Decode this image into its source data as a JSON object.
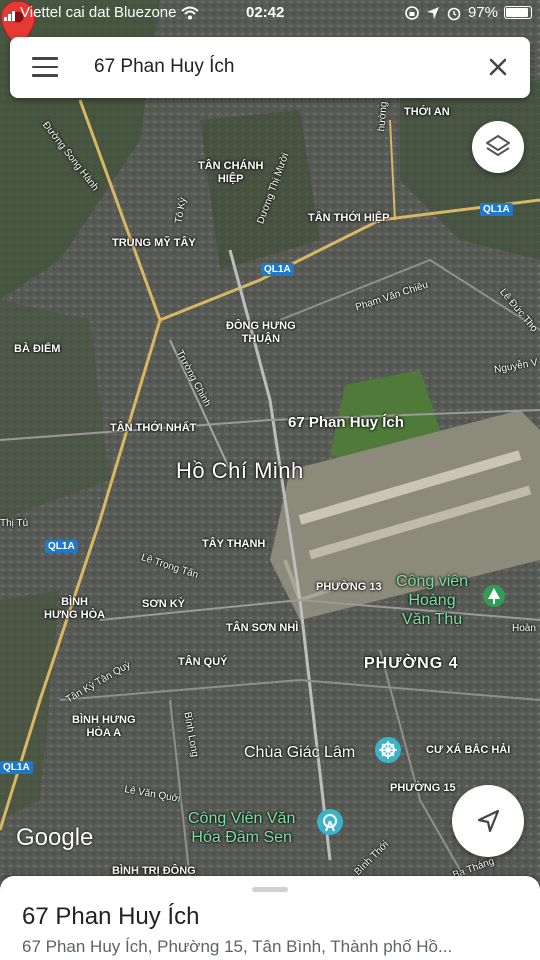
{
  "status_bar": {
    "carrier": "Viettel cai dat Bluezone",
    "time": "02:42",
    "battery": "97%"
  },
  "search": {
    "query": "67 Phan Huy Ích"
  },
  "map": {
    "city_label": "Hồ Chí Minh",
    "pin_label": "67 Phan Huy Ích",
    "attribution": "Google",
    "area_labels": [
      {
        "text": "THỚI AN"
      },
      {
        "text": "TÂN CHÁNH\nHIỆP"
      },
      {
        "text": "TÂN THỚI HIỆP"
      },
      {
        "text": "TRUNG MỸ TÂY"
      },
      {
        "text": "ĐÔNG HƯNG\nTHUẬN"
      },
      {
        "text": "BÀ ĐIỂM"
      },
      {
        "text": "TÂN THỚI NHẤT"
      },
      {
        "text": "TÂY THẠNH"
      },
      {
        "text": "PHƯỜNG 13"
      },
      {
        "text": "BÌNH\nHƯNG HÒA"
      },
      {
        "text": "SƠN KỲ"
      },
      {
        "text": "TÂN SƠN NHÌ"
      },
      {
        "text": "TÂN QUÝ"
      },
      {
        "text": "BÌNH HƯNG\nHÒA A"
      },
      {
        "text": "CƯ XÁ BẮC HẢI"
      },
      {
        "text": "PHƯỜNG 15"
      },
      {
        "text": "BÌNH TRỊ ĐÔNG"
      }
    ],
    "district_label": "PHƯỜNG 4",
    "road_labels": [
      {
        "text": "Đường Song Hành"
      },
      {
        "text": "Dương Thị Mười"
      },
      {
        "text": "Tô Ký"
      },
      {
        "text": "Phạm Văn Chiêu"
      },
      {
        "text": "Lê Đức Thọ"
      },
      {
        "text": "Nguyễn V"
      },
      {
        "text": "Trường Chinh"
      },
      {
        "text": "Lê Trọng Tấn"
      },
      {
        "text": "Tân Kỳ Tân Quý"
      },
      {
        "text": "Bình Long"
      },
      {
        "text": "Lê Văn Quới"
      },
      {
        "text": "Bình Thới"
      },
      {
        "text": "Ba Tháng"
      },
      {
        "text": "Thị Tú"
      },
      {
        "text": "Hoàn"
      },
      {
        "text": "hường"
      }
    ],
    "highway_shields": [
      "QL1A",
      "QL1A",
      "QL1A",
      "QL1A"
    ],
    "pois": [
      {
        "text": "Công viên\nHoàng\nVăn Thụ",
        "type": "park"
      },
      {
        "text": "Chùa Giác Lâm",
        "type": "temple"
      },
      {
        "text": "Công Viên Văn\nHóa Đầm Sen",
        "type": "park"
      }
    ]
  },
  "place_sheet": {
    "title": "67 Phan Huy Ích",
    "address": "67 Phan Huy Ích, Phường 15, Tân Bình, Thành phố Hồ..."
  },
  "colors": {
    "pin": "#e53935",
    "park_text": "#7ee0a4",
    "shield": "#1f78c8",
    "poi_icon": "#3bb3c9"
  }
}
